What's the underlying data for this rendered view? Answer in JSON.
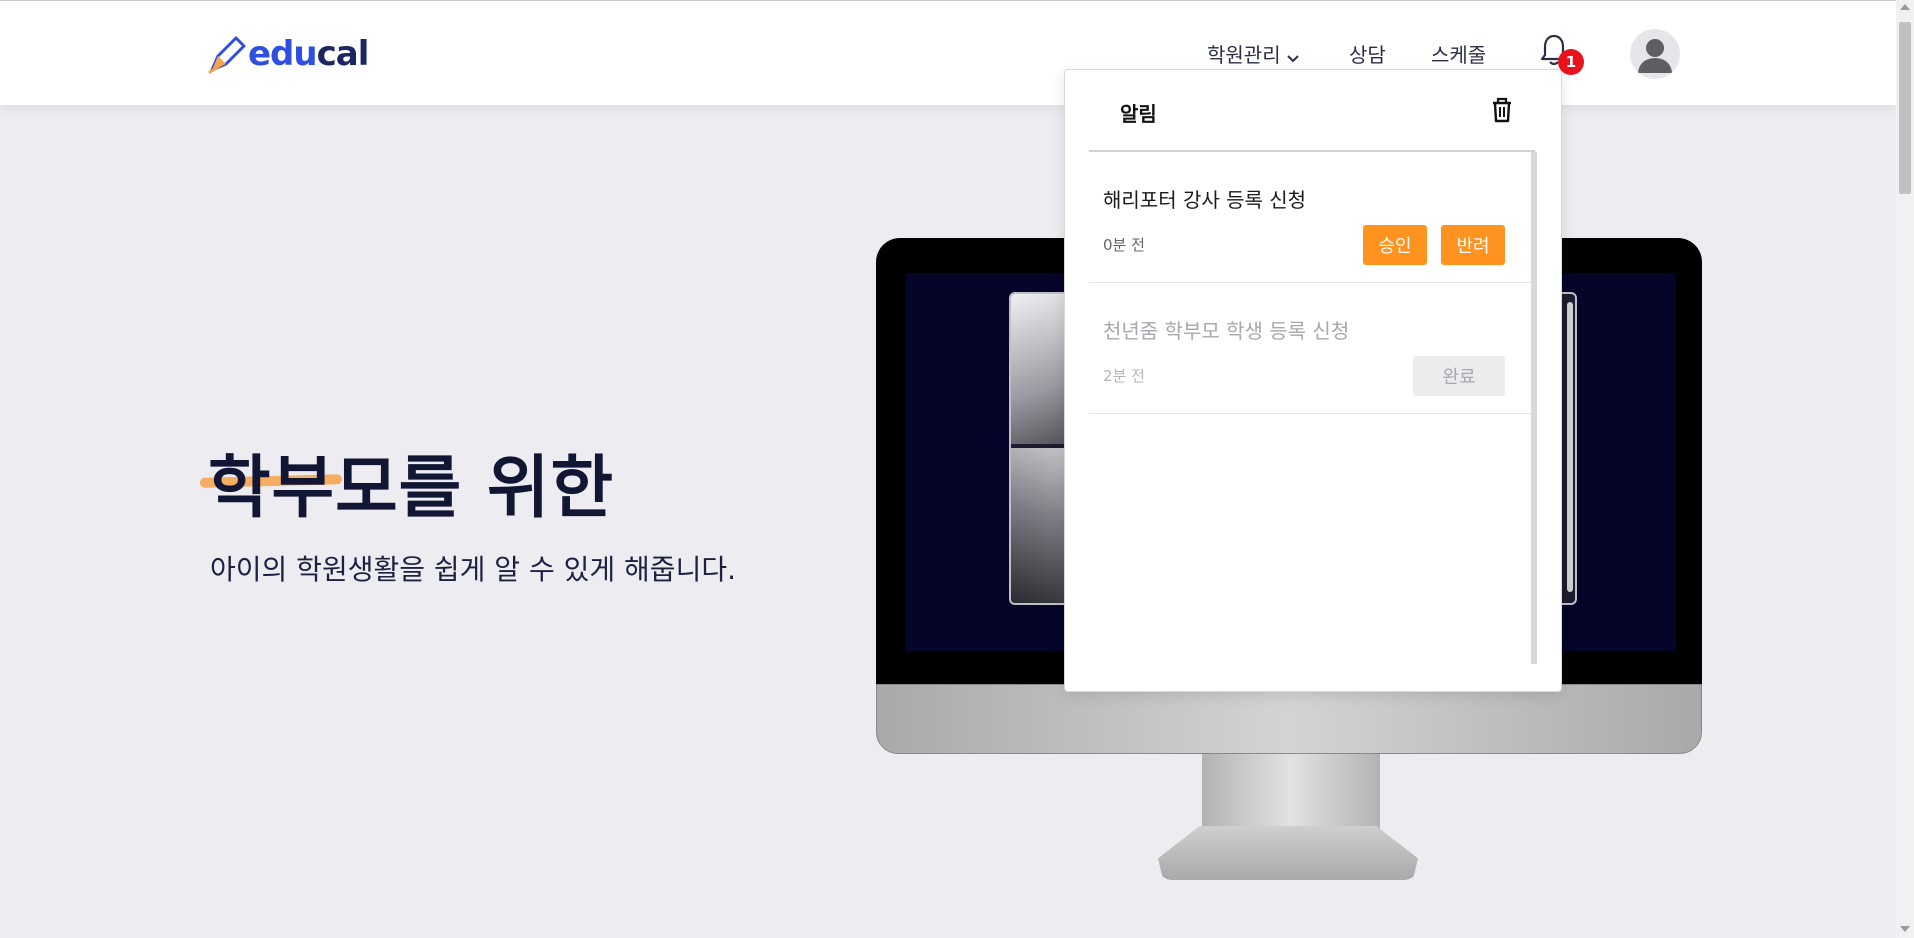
{
  "header": {
    "logo": {
      "part1": "edu",
      "part2": "cal"
    },
    "nav": {
      "academy_label": "학원관리",
      "consult_label": "상담",
      "schedule_label": "스케줄"
    },
    "notification_count": "1"
  },
  "hero": {
    "title": "학부모를 위한",
    "subtitle": "아이의 학원생활을 쉽게 알 수 있게 해줍니다."
  },
  "notifications": {
    "title": "알림",
    "items": [
      {
        "title": "해리포터 강사 등록 신청",
        "time": "0분 전",
        "approve_label": "승인",
        "reject_label": "반려"
      },
      {
        "title": "천년줌 학부모 학생 등록 신청",
        "time": "2분 전",
        "done_label": "완료"
      }
    ]
  },
  "colors": {
    "accent_orange": "#ff9320",
    "brand_blue": "#2f4fe0",
    "badge_red": "#e8131c"
  }
}
